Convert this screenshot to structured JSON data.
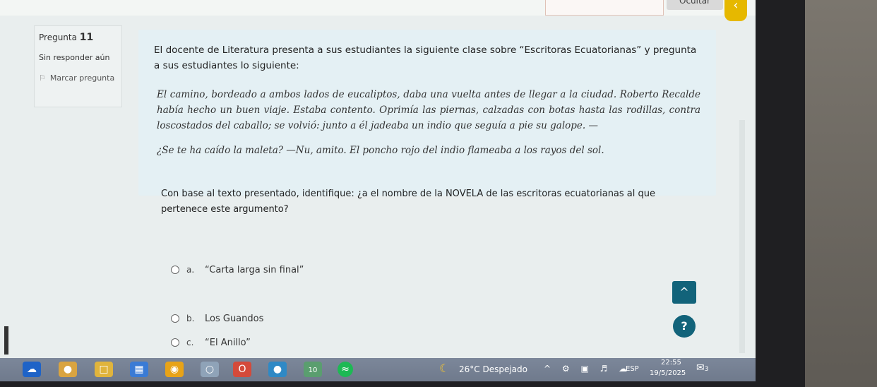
{
  "header": {
    "hide_label": "Ocultar",
    "back_icon": "chevron-left-icon"
  },
  "question_info": {
    "label": "Pregunta",
    "number": "11",
    "status": "Sin responder aún",
    "flag_label": "Marcar pregunta"
  },
  "question": {
    "intro": "El docente de Literatura  presenta a sus estudiantes la siguiente clase sobre “Escritoras Ecuatorianas” y pregunta a sus estudiantes lo siguiente:",
    "passage": "El camino, bordeado a ambos lados de eucaliptos, daba una vuelta antes de llegar a la ciudad. Roberto Recalde había hecho un buen viaje. Estaba contento. Oprimía las piernas, calzadas con botas hasta las rodillas, contra loscostados del caballo; se volvió: junto a él jadeaba un indio que seguía a pie su galope. —",
    "dialog": "¿Se te ha caído la maleta? —Nu, amito. El poncho rojo del indio flameaba a los rayos del sol.",
    "prompt": "Con base al texto presentado, identifique: ¿a el nombre de la NOVELA  de las escritoras ecuatorianas al que pertenece este argumento?"
  },
  "answers": [
    {
      "letter": "a.",
      "text": "“Carta larga sin final”"
    },
    {
      "letter": "b.",
      "text": "Los Guandos"
    },
    {
      "letter": "c.",
      "text": "“El Anillo”"
    }
  ],
  "buttons": {
    "up_label": "^",
    "help_label": "?"
  },
  "taskbar": {
    "calendar_badge": "10",
    "weather": "26°C  Despejado",
    "language": "ESP",
    "time": "22:55",
    "date": "19/5/2025",
    "notifications": "3"
  }
}
